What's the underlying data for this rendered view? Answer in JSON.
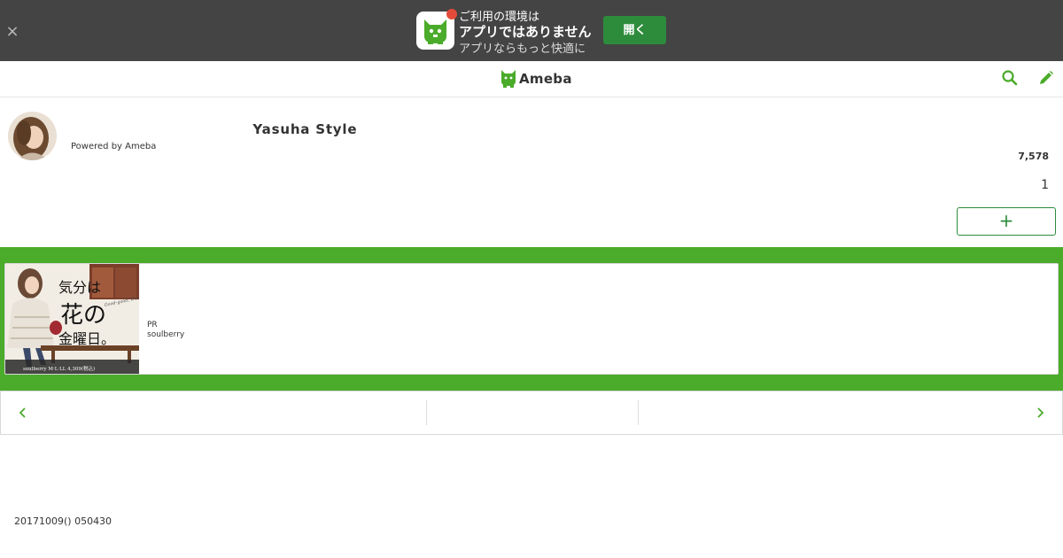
{
  "app_banner": {
    "line1": "ご利用の環境は",
    "line2": "アプリではありません",
    "line3": "アプリならもっと快適に",
    "open_label": "開く",
    "close_glyph": "×"
  },
  "header": {
    "logo_text": "Ameba",
    "brand_color": "#4bab2a",
    "search_icon": "search-icon",
    "edit_icon": "pencil-icon"
  },
  "profile": {
    "blog_title": "　　　　　　　　　　　　　Yasuha Style　",
    "powered_by": "Powered by Ameba",
    "follower_count": "7,578",
    "secondary_count": "1",
    "follow_glyph": "+"
  },
  "ad": {
    "pr_label": "PR",
    "advertiser": "soulberry",
    "image_text_main": "気分は花の金曜日。",
    "image_text_1": "気分は",
    "image_text_2": "花の",
    "image_text_3": "金曜日。",
    "image_text_script": "Good-good, it's friday!",
    "image_caption": "soulberry  M·L·LL  4,309(税込)"
  },
  "pager": {
    "prev_icon": "chevron-left-icon",
    "next_icon": "chevron-right-icon"
  },
  "footer": {
    "date_text": "20171009() 050430"
  }
}
